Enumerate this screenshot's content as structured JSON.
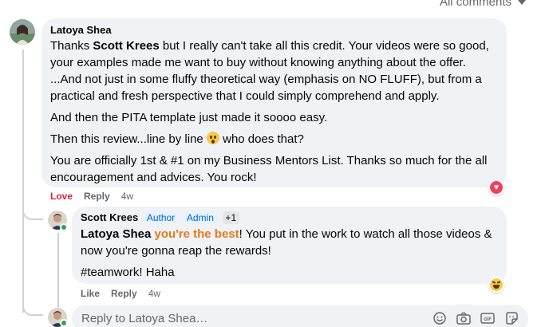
{
  "filter": {
    "label": "All comments"
  },
  "comment": {
    "author": "Latoya Shea",
    "mention": "Scott Krees",
    "line1_pre": "Thanks ",
    "line1_post": " but I really can't take all this credit. Your videos were so good,",
    "line2": "your examples made me want to buy without knowing anything about the offer.",
    "line3": "...And not just in some fluffy theoretical way (emphasis on NO FLUFF), but from a",
    "line4": "practical and fresh perspective that I could simply comprehend and apply.",
    "para2": "And then the PITA template just made it soooo easy.",
    "para3_pre": "Then this review...line by line ",
    "para3_post": " who does that?",
    "para4_line1": "You are officially 1st & #1 on my Business Mentors List. Thanks so much for the all",
    "para4_line2": "encouragement and advices. You rock!",
    "actions": {
      "love": "Love",
      "reply": "Reply",
      "time": "4w"
    },
    "reaction_icon": "heart"
  },
  "reply": {
    "author": "Scott Krees",
    "badges": [
      "Author",
      "Admin",
      "+1"
    ],
    "mention": "Latoya Shea",
    "highlight": "you're the best",
    "line1_post": "! You put in the work to watch all those videos &",
    "line2": "now you're gonna reap the rewards!",
    "para2_tag": "#teamwork",
    "para2_post": "! Haha",
    "actions": {
      "like": "Like",
      "reply": "Reply",
      "time": "4w"
    },
    "reaction_icon": "haha"
  },
  "reply_box": {
    "placeholder": "Reply to Latoya Shea…",
    "tools": [
      "emoji-icon",
      "camera-icon",
      "gif-icon",
      "sticker-icon"
    ]
  },
  "colors": {
    "bubble": "#f0f2f5",
    "love": "#e41e3f",
    "mention": "#e47b1c",
    "badge": "#0064d1",
    "online": "#31a24c"
  }
}
